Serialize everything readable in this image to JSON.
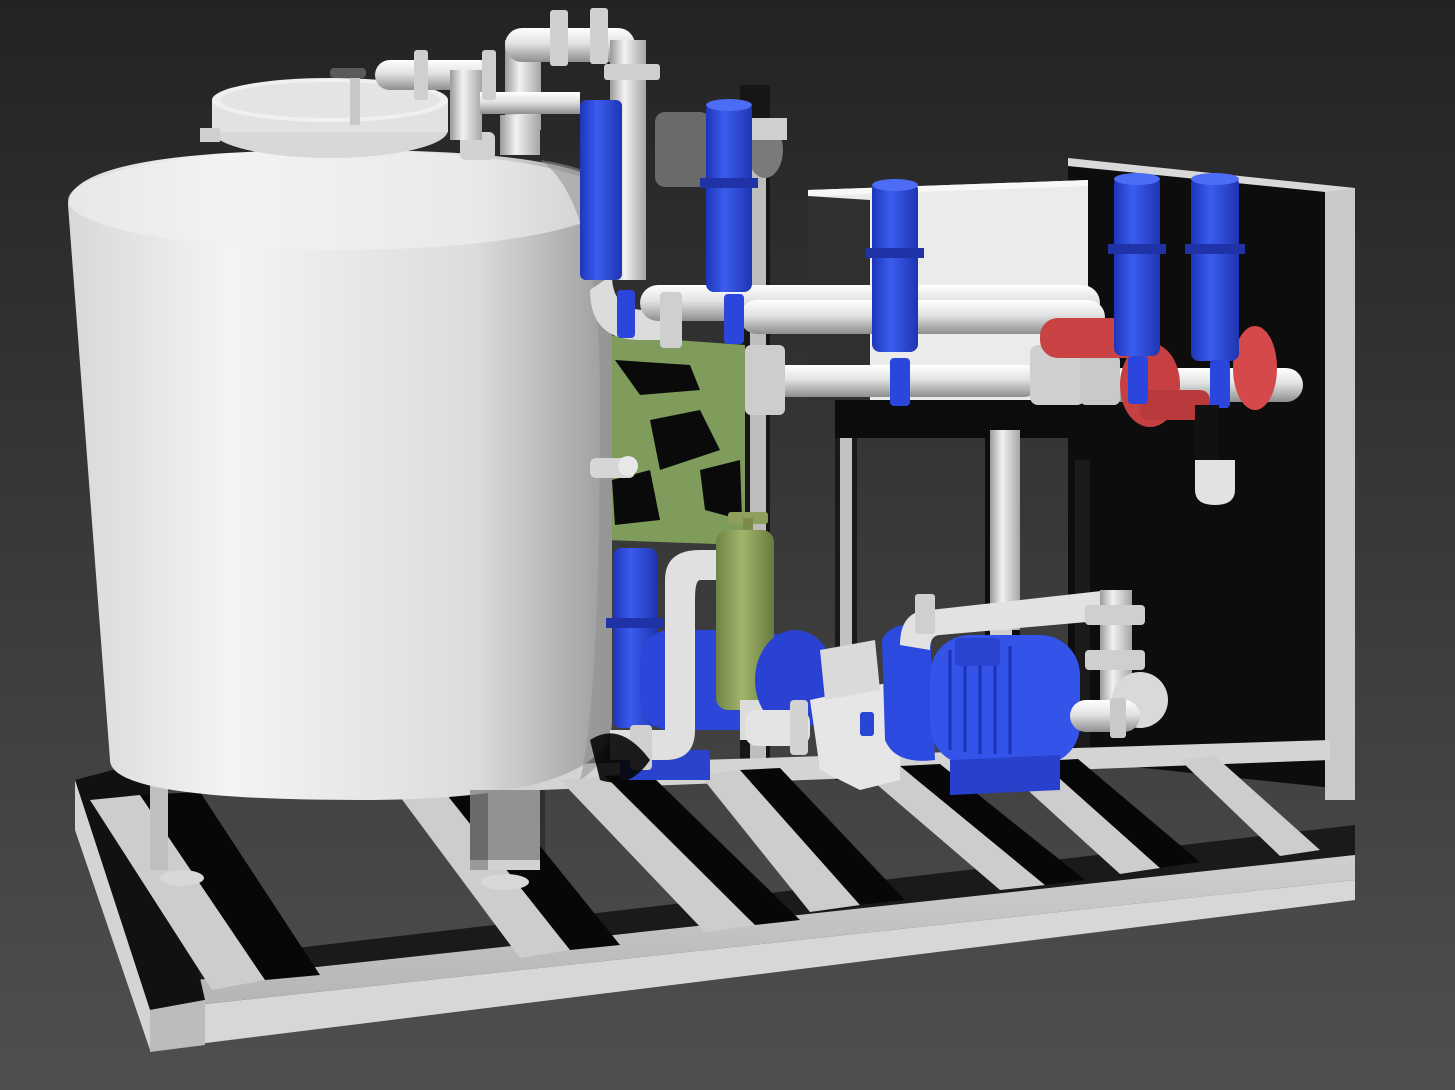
{
  "scene": {
    "colors": {
      "background_top": "#252525",
      "background_bottom": "#4e4e4e",
      "white_metal": "#e9e9e9",
      "white_shade": "#a9a9a9",
      "blue_valve": "#2f4fe6",
      "blue_dark": "#1a2fa8",
      "green_filter": "#8fa35c",
      "green_panel": "#7d9a5a",
      "red_flange": "#d6494b",
      "shadow": "#050505"
    },
    "components": [
      {
        "name": "storage-tank",
        "color": "white_metal"
      },
      {
        "name": "tank-lid",
        "color": "white_metal"
      },
      {
        "name": "base-skid",
        "color": "white_metal"
      },
      {
        "name": "back-panel",
        "color": "white_shade"
      },
      {
        "name": "control-cabinet",
        "color": "white_metal"
      },
      {
        "name": "header-pipes",
        "color": "white_metal"
      },
      {
        "name": "blue-valves",
        "color": "blue_valve"
      },
      {
        "name": "green-filter",
        "color": "green_filter"
      },
      {
        "name": "main-pump-motor",
        "color": "blue_valve"
      },
      {
        "name": "red-flanges",
        "color": "red_flange"
      }
    ]
  }
}
